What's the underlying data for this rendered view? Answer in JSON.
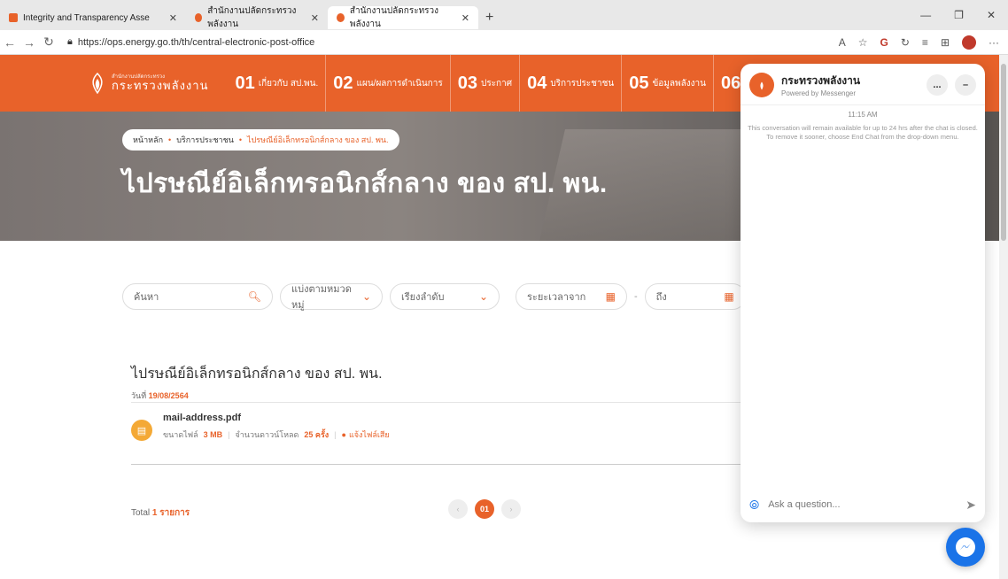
{
  "browser": {
    "tabs": [
      {
        "title": "Integrity and Transparency Asse",
        "active": false
      },
      {
        "title": "สำนักงานปลัดกระทรวงพลังงาน",
        "active": false
      },
      {
        "title": "สำนักงานปลัดกระทรวงพลังงาน",
        "active": true
      }
    ],
    "new_tab": "+",
    "url": "https://ops.energy.go.th/th/central-electronic-post-office"
  },
  "site": {
    "logo_small": "สำนักงานปลัดกระทรวง",
    "logo_big": "กระทรวงพลังงาน",
    "menu": [
      {
        "num": "01",
        "label": "เกี่ยวกับ สป.พน."
      },
      {
        "num": "02",
        "label": "แผน/ผลการดำเนินการ"
      },
      {
        "num": "03",
        "label": "ประกาศ"
      },
      {
        "num": "04",
        "label": "บริการประชาชน"
      },
      {
        "num": "05",
        "label": "ข้อมูลพลังงาน"
      },
      {
        "num": "06",
        "label": ""
      }
    ]
  },
  "hero": {
    "breadcrumb": [
      "หน้าหลัก",
      "บริการประชาชน",
      "ไปรษณีย์อิเล็กทรอนิกส์กลาง ของ สป. พน."
    ],
    "title": "ไปรษณีย์อิเล็กทรอนิกส์กลาง ของ สป. พน."
  },
  "filters": {
    "search_placeholder": "ค้นหา",
    "category": "แบ่งตามหมวดหมู่",
    "sort": "เรียงลำดับ",
    "date_from": "ระยะเวลาจาก",
    "date_to": "ถึง"
  },
  "document": {
    "title": "ไปรษณีย์อิเล็กทรอนิกส์กลาง ของ สป. พน.",
    "date_label": "วันที่",
    "date": "19/08/2564",
    "file_name": "mail-address.pdf",
    "size_label": "ขนาดไฟล์",
    "size": "3 MB",
    "downloads_label": "จำนวนดาวน์โหลด",
    "downloads": "25 ครั้ง",
    "report": "แจ้งไฟล์เสีย"
  },
  "pagination": {
    "total_label": "Total",
    "total": "1 รายการ",
    "current_page": "01"
  },
  "messenger": {
    "name": "กระทรวงพลังงาน",
    "powered": "Powered by Messenger",
    "time": "11:15 AM",
    "notice": "This conversation will remain available for up to 24 hrs after the chat is closed. To remove it sooner, choose End Chat from the drop-down menu.",
    "input_placeholder": "Ask a question...",
    "more": "...",
    "minimize": "–"
  },
  "colors": {
    "brand": "#e8622a",
    "messenger_blue": "#1a73e8"
  }
}
